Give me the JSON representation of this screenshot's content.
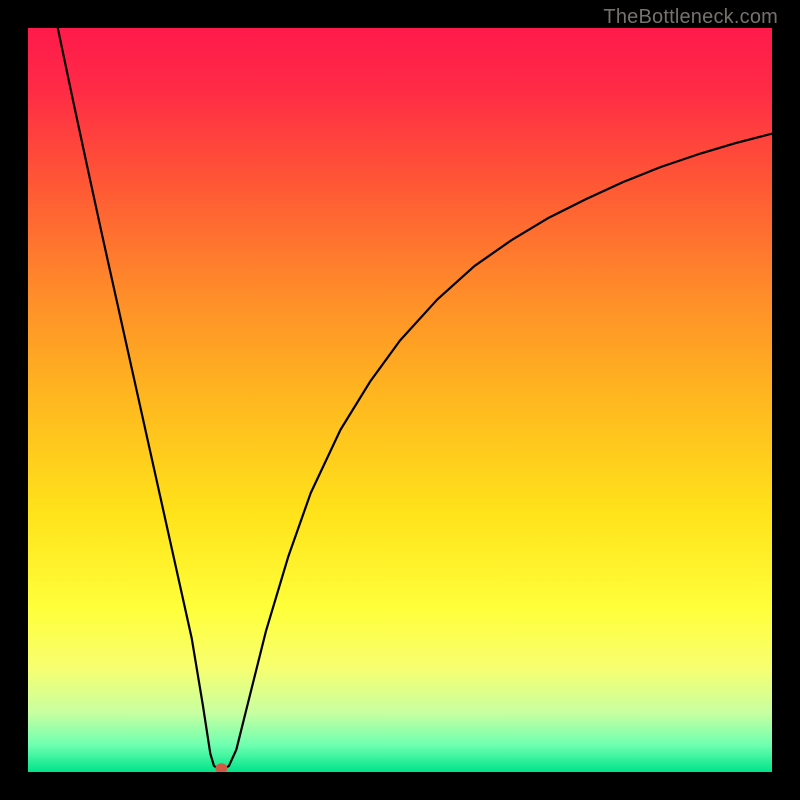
{
  "watermark": "TheBottleneck.com",
  "chart_data": {
    "type": "line",
    "title": "",
    "xlabel": "",
    "ylabel": "",
    "xlim": [
      0,
      100
    ],
    "ylim": [
      0,
      100
    ],
    "grid": false,
    "gradient_stops": [
      {
        "offset": 0.0,
        "color": "#ff1a4b"
      },
      {
        "offset": 0.08,
        "color": "#ff2a46"
      },
      {
        "offset": 0.2,
        "color": "#ff5436"
      },
      {
        "offset": 0.35,
        "color": "#ff8a2a"
      },
      {
        "offset": 0.5,
        "color": "#ffb81f"
      },
      {
        "offset": 0.65,
        "color": "#ffe21a"
      },
      {
        "offset": 0.78,
        "color": "#ffff3a"
      },
      {
        "offset": 0.86,
        "color": "#f7ff70"
      },
      {
        "offset": 0.92,
        "color": "#c8ffa0"
      },
      {
        "offset": 0.965,
        "color": "#6bffb0"
      },
      {
        "offset": 1.0,
        "color": "#00e38a"
      }
    ],
    "marker": {
      "x": 26,
      "y": 0.5,
      "color": "#d15a44",
      "r": 5
    },
    "curve": [
      {
        "x": 4.0,
        "y": 100.0
      },
      {
        "x": 6.0,
        "y": 90.5
      },
      {
        "x": 8.0,
        "y": 81.2
      },
      {
        "x": 10.0,
        "y": 72.0
      },
      {
        "x": 12.0,
        "y": 63.0
      },
      {
        "x": 14.0,
        "y": 54.0
      },
      {
        "x": 16.0,
        "y": 45.0
      },
      {
        "x": 18.0,
        "y": 36.0
      },
      {
        "x": 20.0,
        "y": 27.0
      },
      {
        "x": 22.0,
        "y": 18.0
      },
      {
        "x": 23.5,
        "y": 9.0
      },
      {
        "x": 24.5,
        "y": 2.5
      },
      {
        "x": 25.0,
        "y": 0.8
      },
      {
        "x": 26.0,
        "y": 0.3
      },
      {
        "x": 27.0,
        "y": 0.8
      },
      {
        "x": 28.0,
        "y": 3.0
      },
      {
        "x": 30.0,
        "y": 11.0
      },
      {
        "x": 32.0,
        "y": 19.0
      },
      {
        "x": 35.0,
        "y": 29.0
      },
      {
        "x": 38.0,
        "y": 37.5
      },
      {
        "x": 42.0,
        "y": 46.0
      },
      {
        "x": 46.0,
        "y": 52.5
      },
      {
        "x": 50.0,
        "y": 58.0
      },
      {
        "x": 55.0,
        "y": 63.5
      },
      {
        "x": 60.0,
        "y": 68.0
      },
      {
        "x": 65.0,
        "y": 71.5
      },
      {
        "x": 70.0,
        "y": 74.5
      },
      {
        "x": 75.0,
        "y": 77.0
      },
      {
        "x": 80.0,
        "y": 79.3
      },
      {
        "x": 85.0,
        "y": 81.3
      },
      {
        "x": 90.0,
        "y": 83.0
      },
      {
        "x": 95.0,
        "y": 84.5
      },
      {
        "x": 100.0,
        "y": 85.8
      }
    ]
  }
}
